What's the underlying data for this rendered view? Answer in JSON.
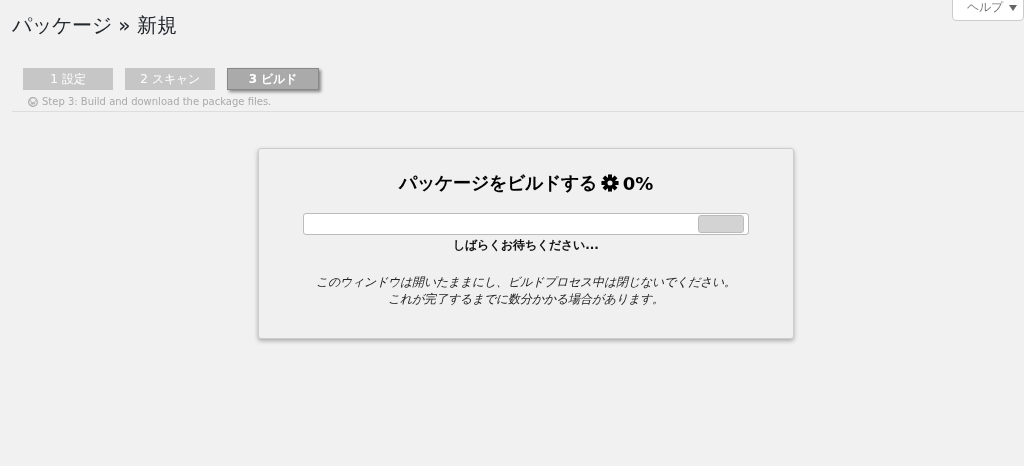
{
  "help_button": {
    "label": "ヘルプ"
  },
  "page_title": "パッケージ » 新規",
  "steps": [
    {
      "label": "1 設定",
      "selected": false
    },
    {
      "label": "2 スキャン",
      "selected": false
    },
    {
      "label": "3 ビルド",
      "selected": true
    }
  ],
  "step_description": "Step 3: Build and download the package files.",
  "build_card": {
    "heading": "パッケージをビルドする",
    "percent": "0%",
    "progress": {
      "level": 0
    },
    "wait_text": "しばらくお待ちください...",
    "notice_lines": [
      "このウィンドウは開いたままにし、ビルドプロセス中は閉じないでください。",
      "これが完了するまでに数分かかる場合があります。"
    ]
  }
}
